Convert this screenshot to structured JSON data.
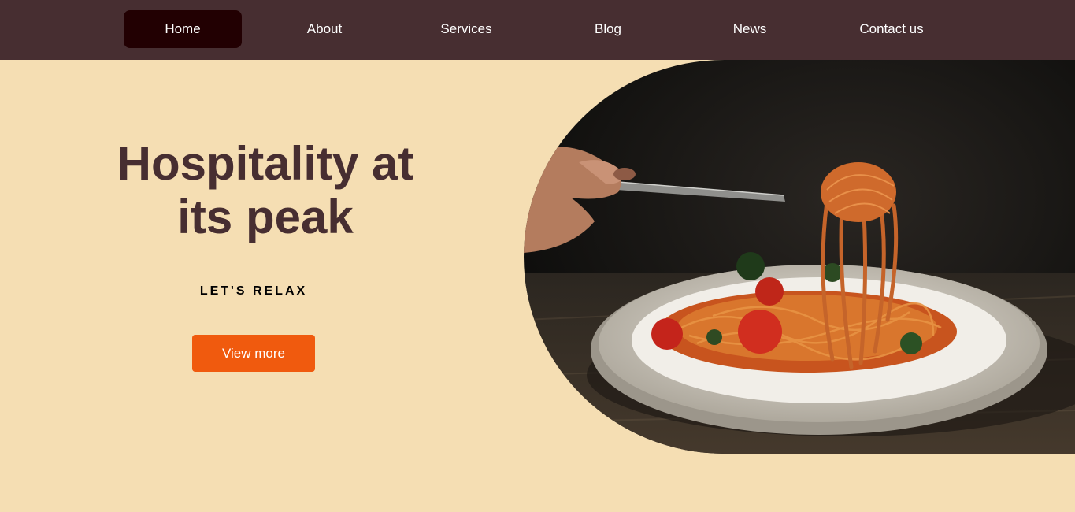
{
  "nav": {
    "items": [
      {
        "label": "Home",
        "active": true
      },
      {
        "label": "About",
        "active": false
      },
      {
        "label": "Services",
        "active": false
      },
      {
        "label": "Blog",
        "active": false
      },
      {
        "label": "News",
        "active": false
      },
      {
        "label": "Contact us",
        "active": false
      }
    ]
  },
  "hero": {
    "title_line1": "Hospitality at",
    "title_line2": "its peak",
    "subtitle": "LET'S RELAX",
    "cta_label": "View more"
  },
  "colors": {
    "nav_bg": "#472e31",
    "nav_active_bg": "#220002",
    "page_bg": "#f5deb3",
    "heading": "#472e31",
    "cta_bg": "#f05a0e"
  }
}
